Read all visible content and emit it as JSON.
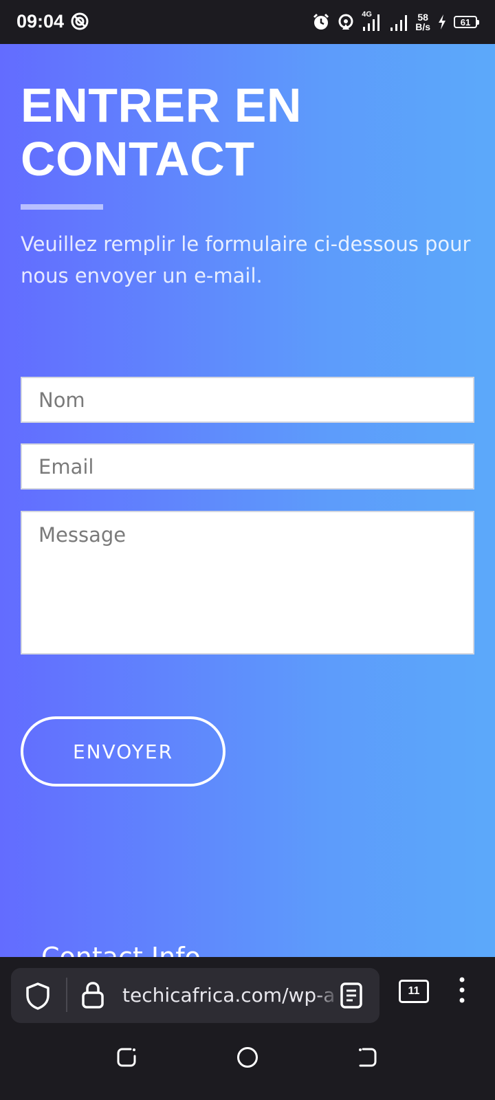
{
  "status_bar": {
    "time": "09:04",
    "net_speed_value": "58",
    "net_speed_unit": "B/s",
    "network_type": "4G",
    "battery_level": "61"
  },
  "page": {
    "headline": "ENTRER EN CONTACT",
    "intro": "Veuillez remplir le formulaire ci-dessous pour nous envoyer un e-mail.",
    "form": {
      "name_placeholder": "Nom",
      "email_placeholder": "Email",
      "message_placeholder": "Message",
      "submit_label": "ENVOYER"
    },
    "contact_info_heading": "Contact Info"
  },
  "browser": {
    "url": "techicafrica.com/wp-a",
    "tab_count": "11"
  },
  "colors": {
    "gradient_start": "#636cff",
    "gradient_end": "#5ca9fa",
    "bar_background": "#1c1b20"
  }
}
